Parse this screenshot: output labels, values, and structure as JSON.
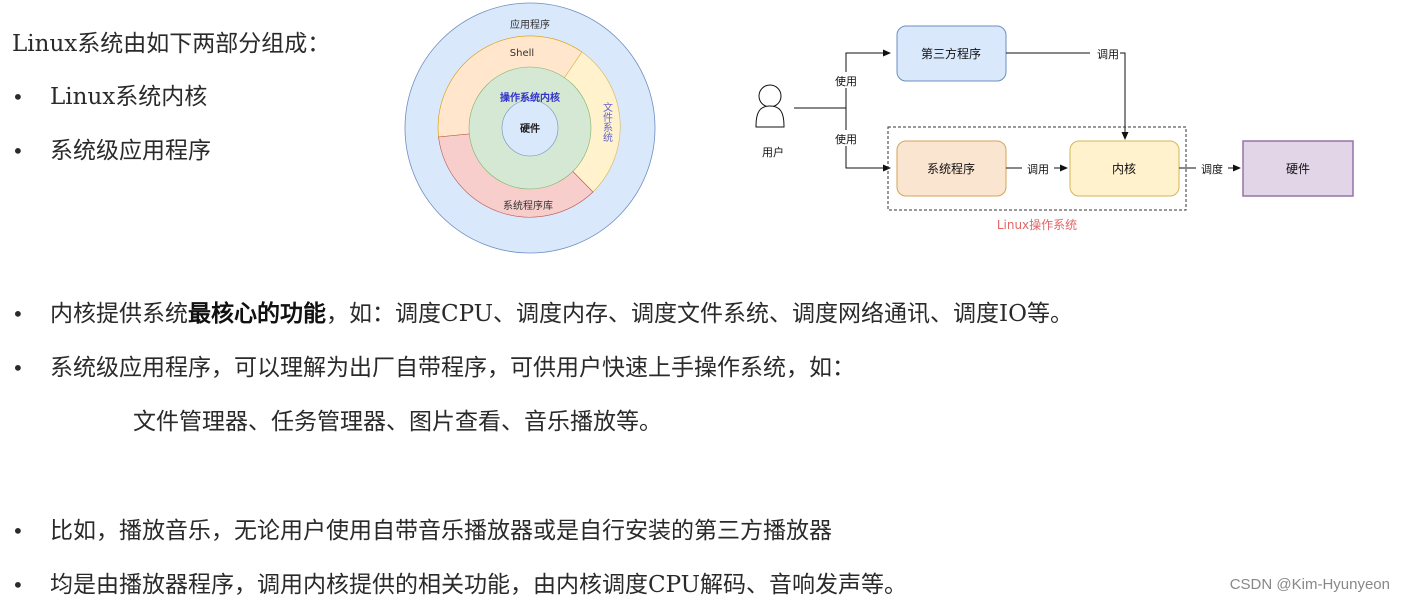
{
  "intro": {
    "heading": "Linux系统由如下两部分组成：",
    "items": [
      "Linux系统内核",
      "系统级应用程序"
    ]
  },
  "ring_diagram": {
    "layers": {
      "outer": "应用程序",
      "shell": "Shell",
      "file_system": "文件系统",
      "libraries": "系统程序库",
      "kernel": "操作系统内核",
      "hardware": "硬件"
    },
    "colors": {
      "outer": "#dae8fc",
      "shell": "#ffe6cc",
      "file_system": "#fff2cc",
      "libraries": "#f8cecc",
      "kernel": "#d5e8d4",
      "hardware": "#dae8fc",
      "kernel_label": "#3333cc",
      "file_system_label": "#6666cc"
    }
  },
  "flow_diagram": {
    "user_label": "用户",
    "use_label_top": "使用",
    "use_label_bottom": "使用",
    "third_party": "第三方程序",
    "call_label_top": "调用",
    "system_programs": "系统程序",
    "call_label_mid": "调用",
    "kernel": "内核",
    "schedule_label": "调度",
    "hardware": "硬件",
    "group_label": "Linux操作系统",
    "colors": {
      "third_party_fill": "#dae8fc",
      "third_party_stroke": "#6c8ebf",
      "system_fill": "#fae5d0",
      "system_stroke": "#d6a356",
      "kernel_fill": "#fff2cc",
      "kernel_stroke": "#d6b656",
      "hardware_fill": "#e1d5e7",
      "hardware_stroke": "#9673a6",
      "group_label": "#e06666"
    }
  },
  "details": {
    "kernel_line": {
      "prefix": "内核提供系统",
      "bold": "最核心的功能",
      "suffix": "，如：调度CPU、调度内存、调度文件系统、调度网络通讯、调度IO等。"
    },
    "apps_line": "系统级应用程序，可以理解为出厂自带程序，可供用户快速上手操作系统，如：",
    "apps_examples": "文件管理器、任务管理器、图片查看、音乐播放等。",
    "example_line_1": "比如，播放音乐，无论用户使用自带音乐播放器或是自行安装的第三方播放器",
    "example_line_2": "均是由播放器程序，调用内核提供的相关功能，由内核调度CPU解码、音响发声等。",
    "bullet": "•"
  },
  "watermark": "CSDN @Kim-Hyunyeon"
}
